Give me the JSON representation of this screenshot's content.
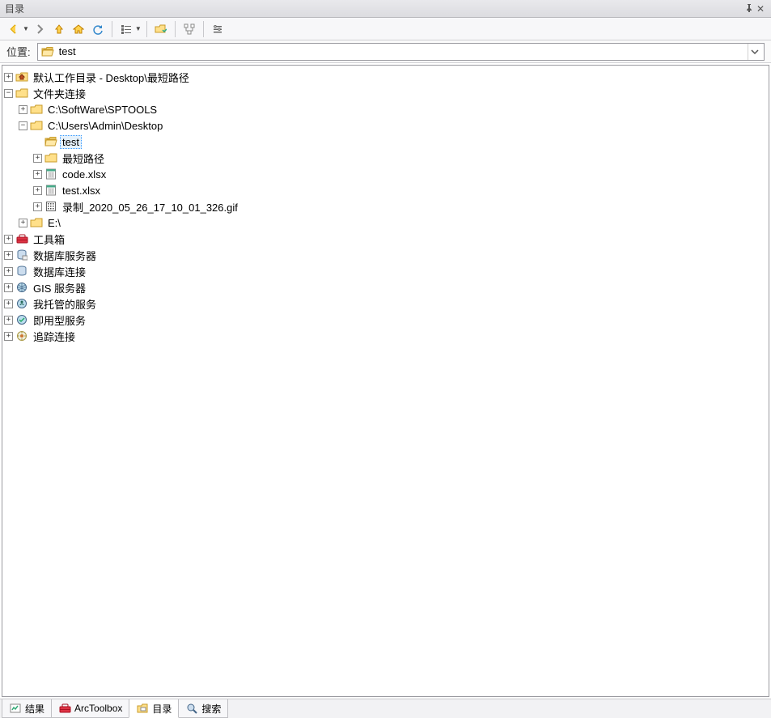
{
  "title": "目录",
  "toolbar": {
    "back": "后退",
    "forward": "前进",
    "up": "上级",
    "home": "主目录",
    "refresh": "刷新",
    "view": "视图",
    "connect": "连接文件夹",
    "tree": "切换树",
    "list": "选项"
  },
  "location": {
    "label": "位置:",
    "value": "test"
  },
  "tree": [
    {
      "indent": 0,
      "expand": "plus",
      "icon": "home-folder",
      "label": "默认工作目录 - Desktop\\最短路径"
    },
    {
      "indent": 0,
      "expand": "minus",
      "icon": "folder",
      "label": "文件夹连接"
    },
    {
      "indent": 1,
      "expand": "plus",
      "icon": "folder",
      "label": "C:\\SoftWare\\SPTOOLS"
    },
    {
      "indent": 1,
      "expand": "minus",
      "icon": "folder",
      "label": "C:\\Users\\Admin\\Desktop"
    },
    {
      "indent": 2,
      "expand": "none",
      "icon": "folder-open",
      "label": "test",
      "selected": true
    },
    {
      "indent": 2,
      "expand": "plus",
      "icon": "folder",
      "label": "最短路径"
    },
    {
      "indent": 2,
      "expand": "plus",
      "icon": "xls",
      "label": "code.xlsx"
    },
    {
      "indent": 2,
      "expand": "plus",
      "icon": "xls",
      "label": "test.xlsx"
    },
    {
      "indent": 2,
      "expand": "plus",
      "icon": "gif",
      "label": "录制_2020_05_26_17_10_01_326.gif"
    },
    {
      "indent": 1,
      "expand": "plus",
      "icon": "folder",
      "label": "E:\\"
    },
    {
      "indent": 0,
      "expand": "plus",
      "icon": "toolbox",
      "label": "工具箱"
    },
    {
      "indent": 0,
      "expand": "plus",
      "icon": "dbserver",
      "label": "数据库服务器"
    },
    {
      "indent": 0,
      "expand": "plus",
      "icon": "dbconn",
      "label": "数据库连接"
    },
    {
      "indent": 0,
      "expand": "plus",
      "icon": "gis",
      "label": "GIS 服务器"
    },
    {
      "indent": 0,
      "expand": "plus",
      "icon": "hosted",
      "label": "我托管的服务"
    },
    {
      "indent": 0,
      "expand": "plus",
      "icon": "ready",
      "label": "即用型服务"
    },
    {
      "indent": 0,
      "expand": "plus",
      "icon": "track",
      "label": "追踪连接"
    }
  ],
  "tabs": [
    {
      "icon": "results",
      "label": "结果",
      "active": false
    },
    {
      "icon": "toolbox",
      "label": "ArcToolbox",
      "active": false
    },
    {
      "icon": "catalog",
      "label": "目录",
      "active": true
    },
    {
      "icon": "search",
      "label": "搜索",
      "active": false
    }
  ]
}
